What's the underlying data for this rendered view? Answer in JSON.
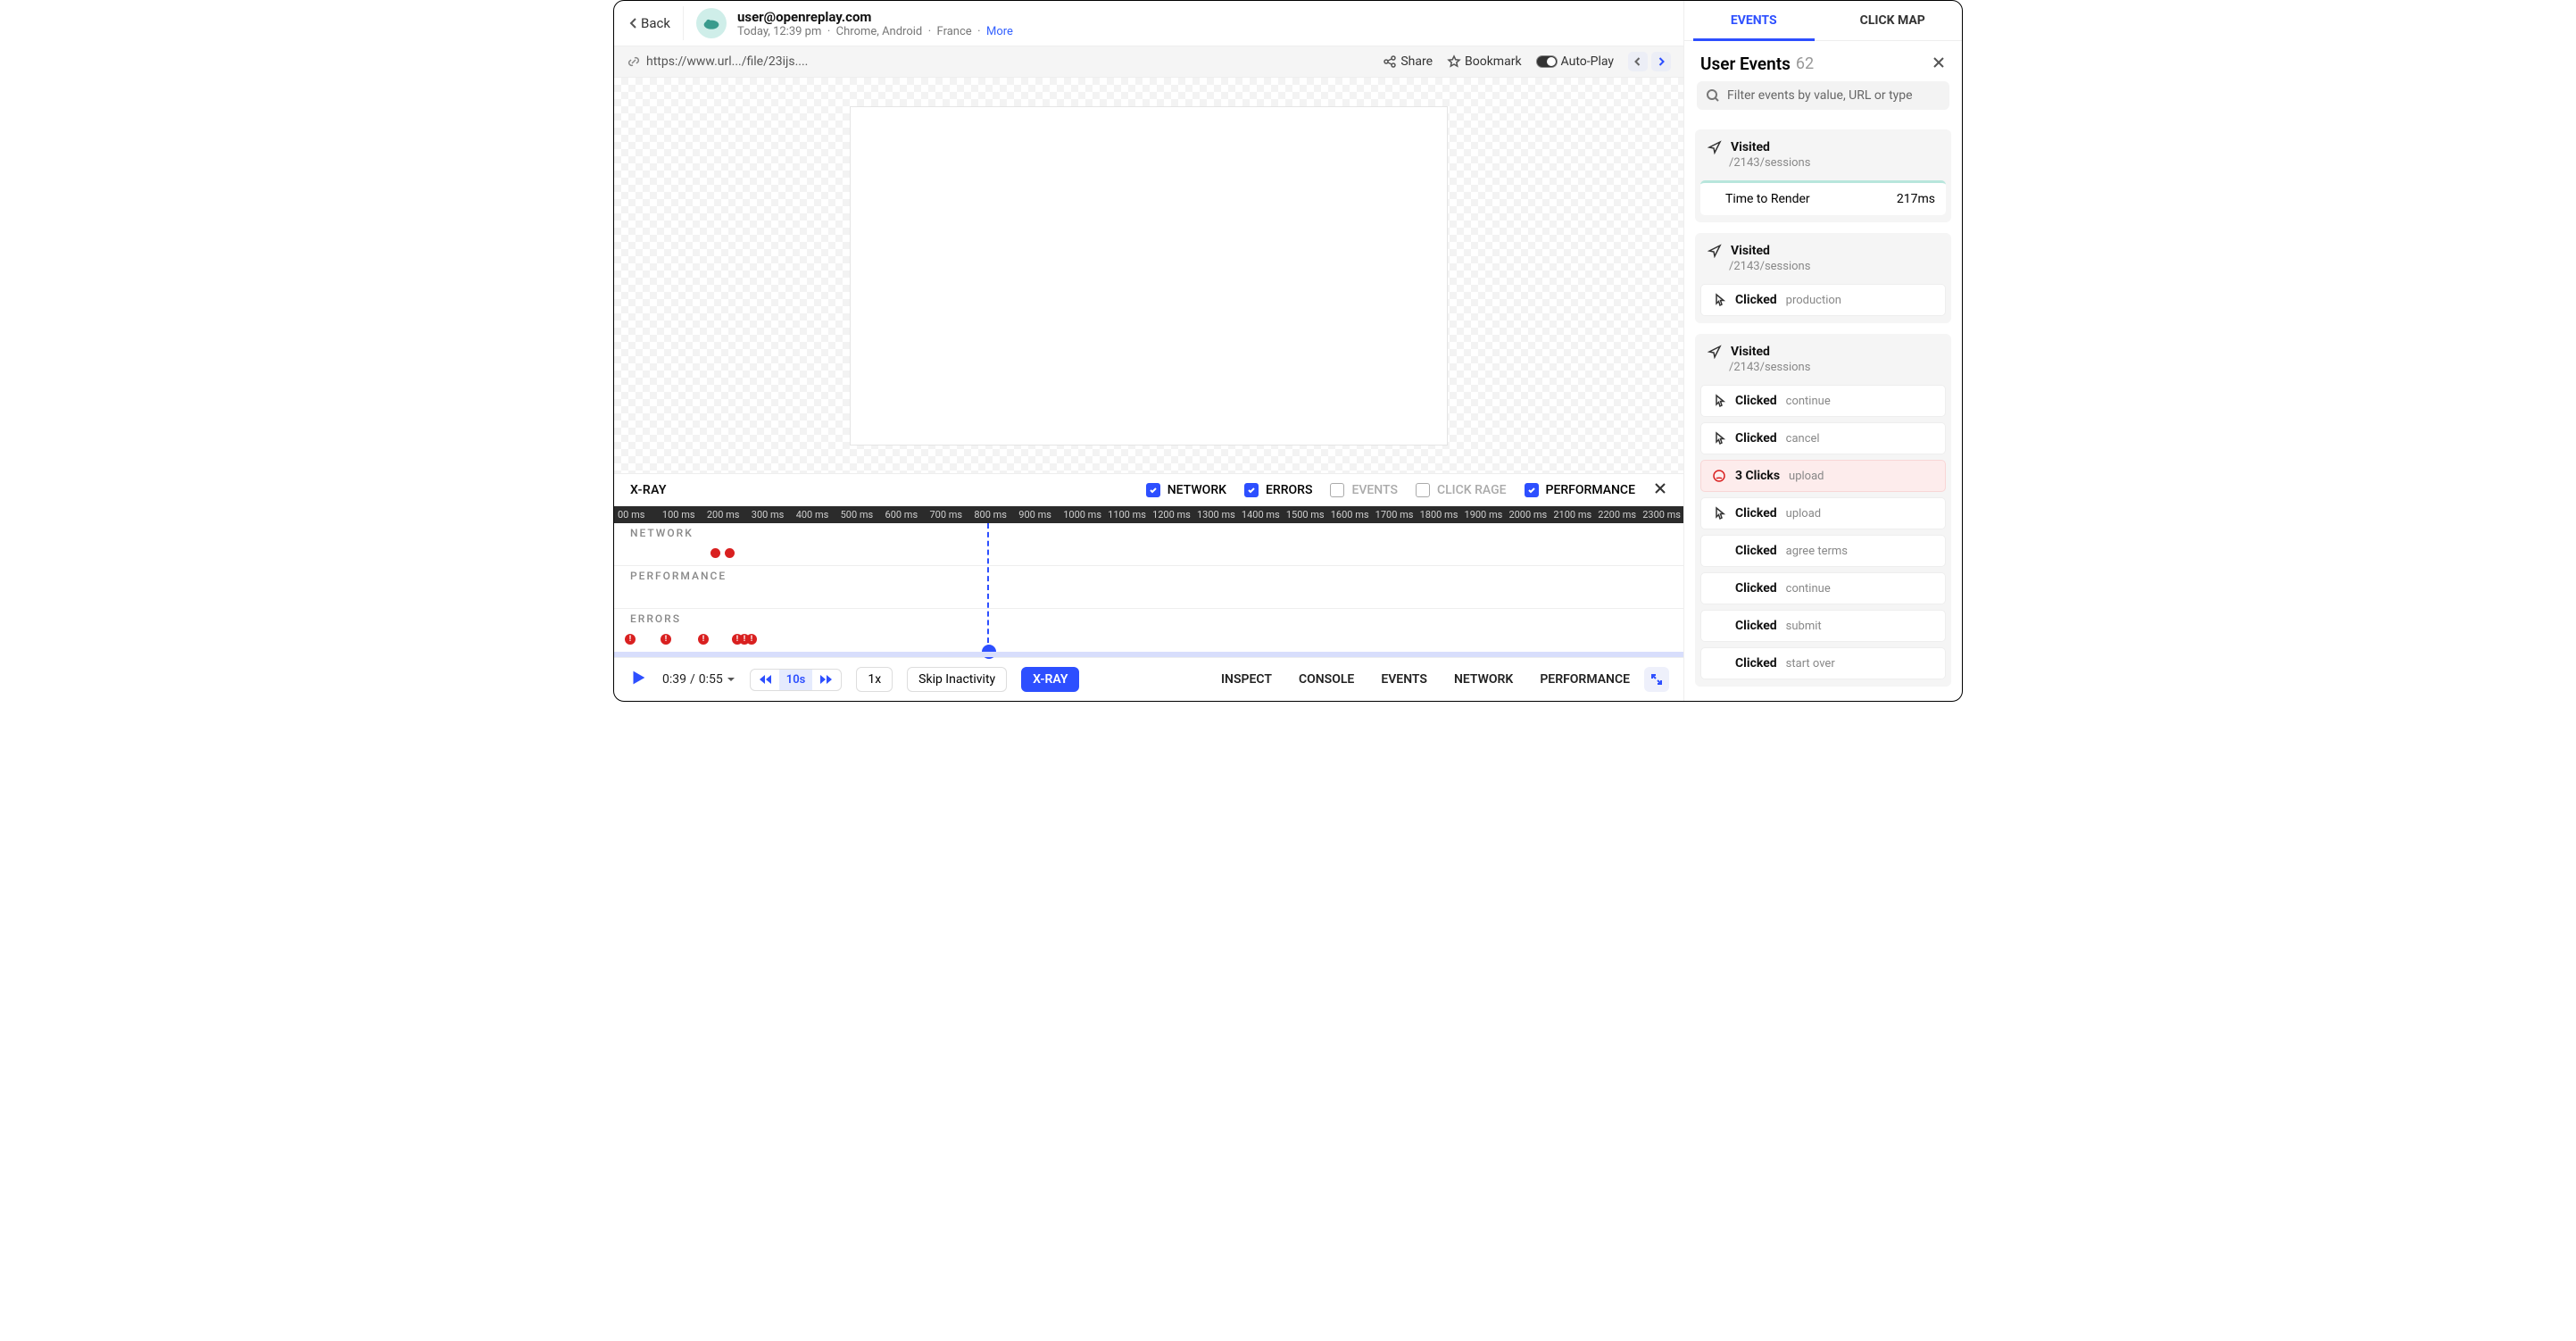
{
  "header": {
    "back_label": "Back",
    "email": "user@openreplay.com",
    "meta_time": "Today, 12:39 pm",
    "meta_browser": "Chrome, Android",
    "meta_location": "France",
    "more_label": "More"
  },
  "urlbar": {
    "url": "https://www.url.../file/23ijs....",
    "share_label": "Share",
    "bookmark_label": "Bookmark",
    "autoplay_label": "Auto-Play"
  },
  "xray": {
    "title": "X-RAY",
    "filters": {
      "network": "NETWORK",
      "errors": "ERRORS",
      "events": "EVENTS",
      "clickrage": "CLICK RAGE",
      "performance": "PERFORMANCE"
    },
    "ruler": [
      "00 ms",
      "100 ms",
      "200 ms",
      "300 ms",
      "400 ms",
      "500 ms",
      "600 ms",
      "700 ms",
      "800 ms",
      "900 ms",
      "1000 ms",
      "1100 ms",
      "1200 ms",
      "1300 ms",
      "1400 ms",
      "1500 ms",
      "1600 ms",
      "1700 ms",
      "1800 ms",
      "1900 ms",
      "2000 ms",
      "2100 ms",
      "2200 ms",
      "2300 ms"
    ],
    "tracks": {
      "network": "NETWORK",
      "performance": "PERFORMANCE",
      "errors": "ERRORS"
    }
  },
  "controls": {
    "time_current": "0:39",
    "time_total": "0:55",
    "skip_amount": "10s",
    "speed": "1x",
    "skip_inactivity": "Skip Inactivity",
    "xray_btn": "X-RAY",
    "tabs": {
      "inspect": "INSPECT",
      "console": "CONSOLE",
      "events": "EVENTS",
      "network": "NETWORK",
      "performance": "PERFORMANCE"
    }
  },
  "sidebar": {
    "tabs": {
      "events": "EVENTS",
      "clickmap": "CLICK MAP"
    },
    "title": "User Events",
    "count": "62",
    "search_placeholder": "Filter events by value, URL or type",
    "blocks": [
      {
        "visited_label": "Visited",
        "visited_path": "/2143/sessions",
        "render_label": "Time to Render",
        "render_value": "217ms"
      },
      {
        "visited_label": "Visited",
        "visited_path": "/2143/sessions",
        "cards": [
          {
            "type": "click",
            "label": "Clicked",
            "value": "production"
          }
        ]
      },
      {
        "visited_label": "Visited",
        "visited_path": "/2143/sessions",
        "cards": [
          {
            "type": "click",
            "label": "Clicked",
            "value": "continue"
          },
          {
            "type": "click",
            "label": "Clicked",
            "value": "cancel"
          },
          {
            "type": "rage",
            "label": "3 Clicks",
            "value": "upload"
          },
          {
            "type": "click",
            "label": "Clicked",
            "value": "upload"
          },
          {
            "type": "plain",
            "label": "Clicked",
            "value": "agree terms"
          },
          {
            "type": "plain",
            "label": "Clicked",
            "value": "continue"
          },
          {
            "type": "plain",
            "label": "Clicked",
            "value": "submit"
          },
          {
            "type": "plain",
            "label": "Clicked",
            "value": "start over"
          }
        ]
      }
    ]
  }
}
